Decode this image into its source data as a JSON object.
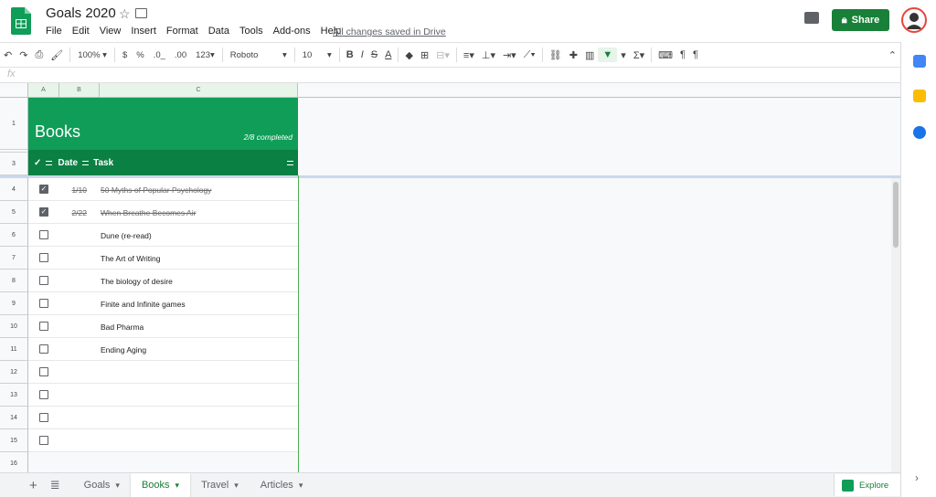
{
  "document": {
    "title": "Goals 2020",
    "saved_status": "All changes saved in Drive"
  },
  "menu": [
    "File",
    "Edit",
    "View",
    "Insert",
    "Format",
    "Data",
    "Tools",
    "Add-ons",
    "Help"
  ],
  "share_label": "Share",
  "toolbar": {
    "zoom": "100%",
    "currency": "$",
    "percent": "%",
    "dec_less": ".0_",
    "dec_more": ".00",
    "number_format": "123▾",
    "font": "Roboto",
    "font_size": "10"
  },
  "formula_bar": {
    "fx": "fx",
    "value": ""
  },
  "columns": [
    "A",
    "B",
    "C"
  ],
  "sheet": {
    "heading": "Books",
    "progress": "2/8 completed",
    "header_check": "✓",
    "header_date": "Date",
    "header_task": "Task",
    "row_numbers": [
      "1",
      "2",
      "3",
      "4",
      "5",
      "6",
      "7",
      "8",
      "9",
      "10",
      "11",
      "12",
      "13",
      "14",
      "15",
      "16"
    ],
    "rows": [
      {
        "checked": true,
        "date": "1/10",
        "task": "50 Myths of Popular Psychology"
      },
      {
        "checked": true,
        "date": "2/22",
        "task": "When Breathe Becomes Air"
      },
      {
        "checked": false,
        "date": "",
        "task": "Dune (re-read)"
      },
      {
        "checked": false,
        "date": "",
        "task": "The Art of Writing"
      },
      {
        "checked": false,
        "date": "",
        "task": "The biology of desire"
      },
      {
        "checked": false,
        "date": "",
        "task": "Finite and Infinite games"
      },
      {
        "checked": false,
        "date": "",
        "task": "Bad Pharma"
      },
      {
        "checked": false,
        "date": "",
        "task": "Ending Aging"
      },
      {
        "checked": false,
        "date": "",
        "task": ""
      },
      {
        "checked": false,
        "date": "",
        "task": ""
      },
      {
        "checked": false,
        "date": "",
        "task": ""
      },
      {
        "checked": false,
        "date": "",
        "task": ""
      }
    ]
  },
  "tabs": [
    {
      "label": "Goals",
      "active": false
    },
    {
      "label": "Books",
      "active": true
    },
    {
      "label": "Travel",
      "active": false
    },
    {
      "label": "Articles",
      "active": false
    }
  ],
  "explore_label": "Explore",
  "colors": {
    "accent": "#0f9d58",
    "accent_dark": "#0b8043",
    "share": "#188038"
  }
}
